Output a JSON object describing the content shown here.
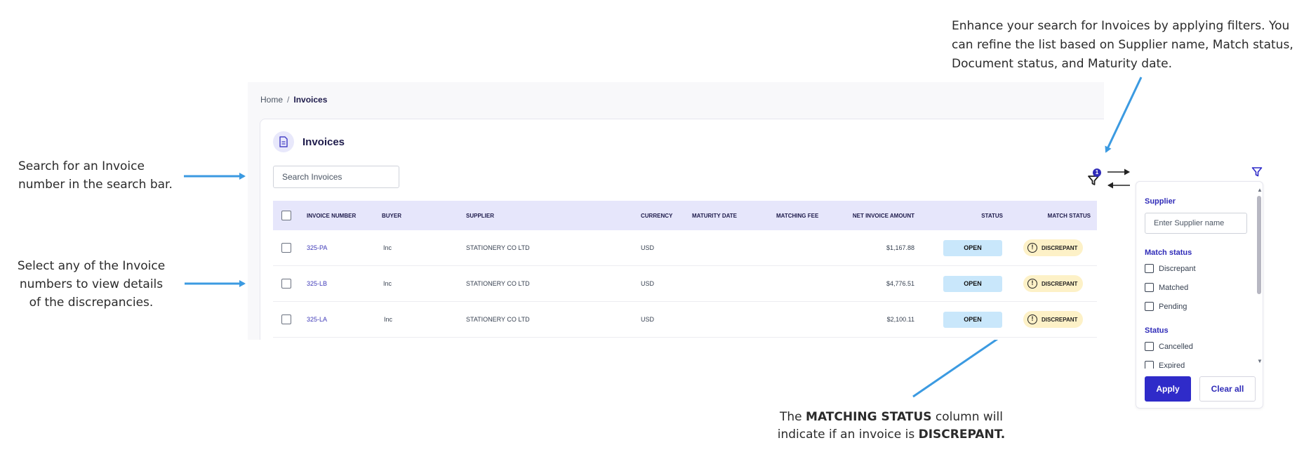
{
  "annotations": {
    "search_note": "Search for an Invoice number in the search bar.",
    "select_note": "Select any of the Invoice numbers to view details of the discrepancies.",
    "filter_note": "Enhance your search for Invoices by applying filters. You can refine the list based on Supplier name, Match status, Document status, and Maturity date.",
    "match_note": {
      "p1": "The ",
      "b1": "MATCHING STATUS",
      "p2": " column will indicate if an invoice is ",
      "b2": "DISCREPANT."
    }
  },
  "breadcrumb": {
    "home": "Home",
    "separator": "/",
    "current": "Invoices"
  },
  "page": {
    "title": "Invoices",
    "search_placeholder": "Search Invoices",
    "filter_count": "1"
  },
  "table": {
    "columns": {
      "invoice_number": "INVOICE NUMBER",
      "buyer": "BUYER",
      "supplier": "SUPPLIER",
      "currency": "CURRENCY",
      "maturity_date": "MATURITY DATE",
      "matching_fee": "MATCHING FEE",
      "net_invoice_amount": "NET INVOICE AMOUNT",
      "status": "STATUS",
      "match_status": "MATCH STATUS"
    },
    "rows": [
      {
        "invoice_number": "325-PA",
        "buyer": "Inc",
        "supplier": "STATIONERY CO LTD",
        "currency": "USD",
        "maturity_date": "",
        "matching_fee": "",
        "net_invoice_amount": "$1,167.88",
        "status": "OPEN",
        "match_status": "DISCREPANT"
      },
      {
        "invoice_number": "325-LB",
        "buyer": "Inc",
        "supplier": "STATIONERY CO LTD",
        "currency": "USD",
        "maturity_date": "",
        "matching_fee": "",
        "net_invoice_amount": "$4,776.51",
        "status": "OPEN",
        "match_status": "DISCREPANT"
      },
      {
        "invoice_number": "325-LA",
        "buyer": "Inc",
        "supplier": "STATIONERY CO LTD",
        "currency": "USD",
        "maturity_date": "",
        "matching_fee": "",
        "net_invoice_amount": "$2,100.11",
        "status": "OPEN",
        "match_status": "DISCREPANT"
      }
    ]
  },
  "filter_panel": {
    "supplier_title": "Supplier",
    "supplier_placeholder": "Enter Supplier name",
    "match_status_title": "Match status",
    "match_options": [
      "Discrepant",
      "Matched",
      "Pending"
    ],
    "status_title": "Status",
    "status_options": [
      "Cancelled",
      "Expired"
    ],
    "apply_label": "Apply",
    "clear_label": "Clear all"
  },
  "colors": {
    "accent": "#2f2bc9",
    "header_row": "#e6e6fb",
    "open_badge": "#c9e7fb",
    "discrepant_badge": "#fdf1c7",
    "callout_arrow": "#3b9ae1"
  },
  "icons": [
    "document-icon",
    "filter-icon",
    "info-icon"
  ]
}
